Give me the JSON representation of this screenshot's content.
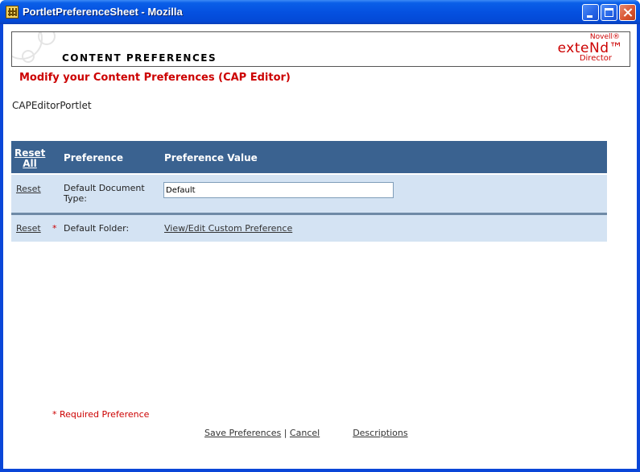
{
  "window": {
    "title": "PortletPreferenceSheet - Mozilla"
  },
  "banner": {
    "title": "CONTENT PREFERENCES",
    "logo_top": "Novell®",
    "logo_mid": "exteNd™",
    "logo_bottom": "Director"
  },
  "page": {
    "heading": "Modify your Content Preferences (CAP Editor)",
    "portlet_name": "CAPEditorPortlet"
  },
  "table": {
    "headers": {
      "reset_all": "Reset All",
      "preference": "Preference",
      "value": "Preference Value"
    },
    "rows": [
      {
        "reset": "Reset",
        "required": false,
        "label": "Default Document Type:",
        "value": "Default"
      },
      {
        "reset": "Reset",
        "required": true,
        "star": "*",
        "label": "Default Folder:",
        "link": "View/Edit Custom Preference"
      }
    ]
  },
  "footer": {
    "required_note": "* Required Preference",
    "save": "Save Preferences",
    "divider": "|",
    "cancel": "Cancel",
    "descriptions": "Descriptions"
  },
  "colors": {
    "header_bg": "#3a6290",
    "row_bg": "#d4e3f3",
    "accent_red": "#cc0000",
    "titlebar_blue": "#0551e0"
  }
}
